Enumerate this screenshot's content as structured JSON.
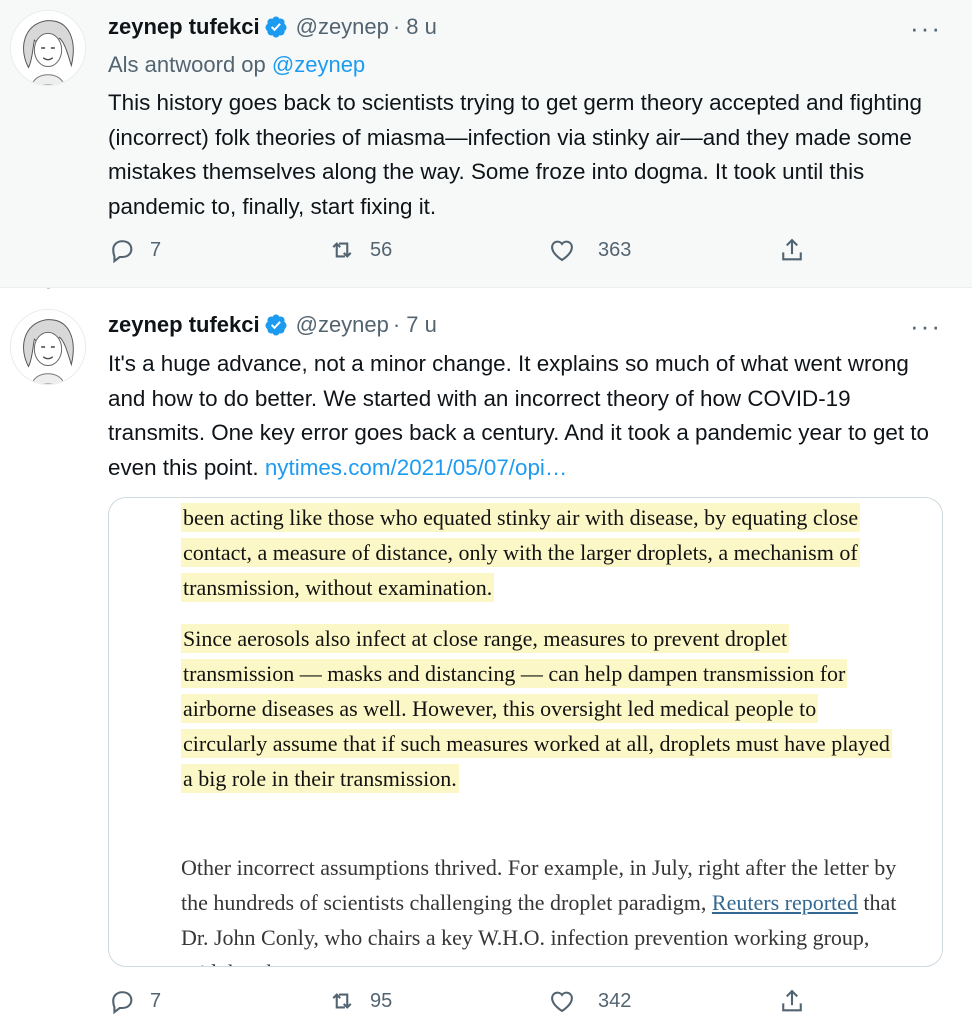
{
  "tweets": [
    {
      "author_name": "zeynep tufekci",
      "handle": "@zeynep",
      "time": "8 u",
      "reply_prefix": "Als antwoord op",
      "reply_mention": "@zeynep",
      "text": "This history goes back to scientists trying to get germ theory accepted and fighting (incorrect) folk theories of miasma—infection via stinky air—and they made some mistakes themselves along the way. Some froze into dogma. It took until this pandemic to, finally, start fixing it.",
      "replies": "7",
      "retweets": "56",
      "likes": "363"
    },
    {
      "author_name": "zeynep tufekci",
      "handle": "@zeynep",
      "time": "7 u",
      "text": "It's a huge advance, not a minor change. It explains so much of what went wrong and how to do better. We started with an incorrect theory of how COVID-19 transmits. One key error goes back a century. And it took a pandemic year to get to even this point.",
      "link": "nytimes.com/2021/05/07/opi…",
      "replies": "7",
      "retweets": "95",
      "likes": "342",
      "article": {
        "para1": "been acting like those who equated stinky air with disease, by equating close contact, a measure of distance, only with the larger droplets, a mechanism of transmission, without examination.",
        "para2": "Since aerosols also infect at close range, measures to prevent droplet transmission — masks and distancing — can help dampen transmission for airborne diseases as well. However, this oversight led medical people to circularly assume that if such measures worked at all, droplets must have played a big role in their transmission.",
        "para3_before": "Other incorrect assumptions thrived. For example, in July, right after the letter by the hundreds of scientists challenging the droplet paradigm,",
        "para3_link": "Reuters reported",
        "para3_after": "that Dr. John Conly, who chairs",
        "para3_cut": "a key W.H.O. infection prevention working group, said that there"
      }
    }
  ],
  "icons": {
    "reply": "reply-icon",
    "retweet": "retweet-icon",
    "like": "heart-icon",
    "share": "share-icon",
    "more": "more-icon",
    "verified": "verified-badge-icon"
  },
  "colors": {
    "accent": "#1d9bf0",
    "secondary_text": "#536471",
    "highlight": "#fcf7c6"
  }
}
